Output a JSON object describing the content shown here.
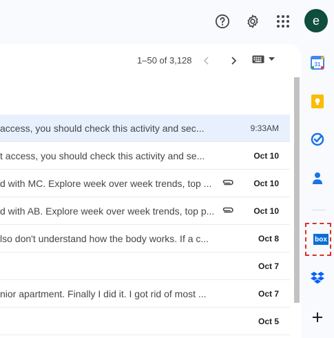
{
  "header": {
    "avatar_letter": "e",
    "icons": [
      "help-icon",
      "settings-icon",
      "apps-grid-icon"
    ]
  },
  "toolbar": {
    "pagination": "1–50 of 3,128"
  },
  "emails": [
    {
      "snippet": "access, you should check this activity and sec...",
      "date": "9:33AM",
      "read": true,
      "selected": true,
      "attachment": false
    },
    {
      "snippet": "t access, you should check this activity and se...",
      "date": "Oct 10",
      "read": false,
      "selected": false,
      "attachment": false
    },
    {
      "snippet": "d with MC. Explore week over week trends, top ...",
      "date": "Oct 10",
      "read": false,
      "selected": false,
      "attachment": true
    },
    {
      "snippet": "d with AB. Explore week over week trends, top p...",
      "date": "Oct 10",
      "read": false,
      "selected": false,
      "attachment": true
    },
    {
      "snippet": "lso don't understand how the body works. If a c...",
      "date": "Oct 8",
      "read": false,
      "selected": false,
      "attachment": false
    },
    {
      "snippet": "",
      "date": "Oct 7",
      "read": false,
      "selected": false,
      "attachment": false
    },
    {
      "snippet": "nior apartment. Finally I did it. I got rid of most ...",
      "date": "Oct 7",
      "read": false,
      "selected": false,
      "attachment": false
    },
    {
      "snippet": "",
      "date": "Oct 5",
      "read": false,
      "selected": false,
      "attachment": false
    }
  ],
  "side_panel": {
    "calendar_day": "31",
    "box_label": "box",
    "apps": [
      "calendar-icon",
      "keep-icon",
      "tasks-icon",
      "contacts-icon",
      "box-icon",
      "dropbox-icon",
      "add-icon"
    ]
  },
  "colors": {
    "accent": "#0b57d0",
    "avatar_bg": "#0f4d3c",
    "highlight": "#d93025",
    "selected_row": "#e8f0fe"
  }
}
